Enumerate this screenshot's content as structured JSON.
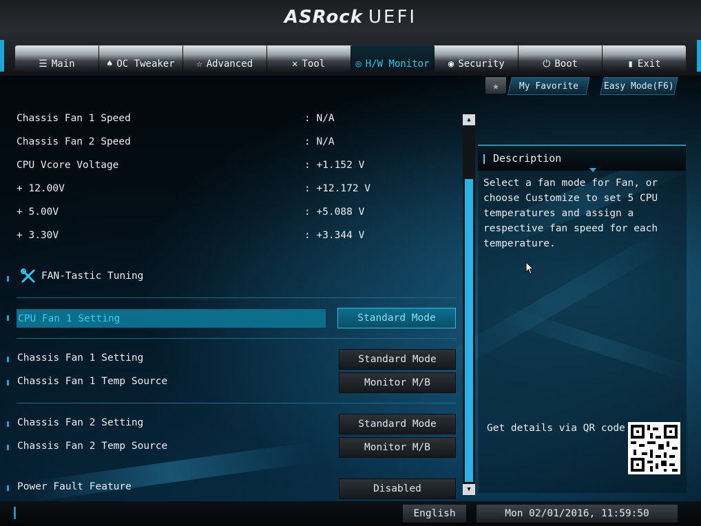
{
  "brand": {
    "name": "ASRock",
    "suffix": "UEFI"
  },
  "tabs": [
    {
      "icon": "list-icon",
      "glyph": "☰",
      "label": "Main"
    },
    {
      "icon": "flame-icon",
      "glyph": "♠",
      "label": "OC Tweaker"
    },
    {
      "icon": "star-icon",
      "glyph": "☆",
      "label": "Advanced"
    },
    {
      "icon": "tools-icon",
      "glyph": "✕",
      "label": "Tool"
    },
    {
      "icon": "monitor-icon",
      "glyph": "◎",
      "label": "H/W Monitor"
    },
    {
      "icon": "shield-icon",
      "glyph": "◉",
      "label": "Security"
    },
    {
      "icon": "power-icon",
      "glyph": "⏻",
      "label": "Boot"
    },
    {
      "icon": "exit-icon",
      "glyph": "▮",
      "label": "Exit"
    }
  ],
  "active_tab": "H/W Monitor",
  "favorites": {
    "my_favorite": "My Favorite",
    "easy_mode": "Easy Mode(F6)"
  },
  "readings": [
    {
      "label": "Chassis Fan 1 Speed",
      "value": ": N/A"
    },
    {
      "label": "Chassis Fan 2 Speed",
      "value": ": N/A"
    },
    {
      "label": "CPU Vcore Voltage",
      "value": ": +1.152 V"
    },
    {
      "label": "+ 12.00V",
      "value": ": +12.172 V"
    },
    {
      "label": "+ 5.00V",
      "value": ": +5.088 V"
    },
    {
      "label": "+ 3.30V",
      "value": ": +3.344 V"
    }
  ],
  "fan_tastic": {
    "label": "FAN-Tastic Tuning"
  },
  "settings": {
    "cpu_fan1": {
      "label": "CPU Fan 1 Setting",
      "value": "Standard Mode"
    },
    "chassis_fan1": {
      "label": "Chassis Fan 1 Setting",
      "value": "Standard Mode"
    },
    "chassis_fan1_src": {
      "label": "Chassis Fan 1 Temp Source",
      "value": "Monitor M/B"
    },
    "chassis_fan2": {
      "label": "Chassis Fan 2 Setting",
      "value": "Standard Mode"
    },
    "chassis_fan2_src": {
      "label": "Chassis Fan 2 Temp Source",
      "value": "Monitor M/B"
    },
    "power_fault": {
      "label": "Power Fault Feature",
      "value": "Disabled"
    }
  },
  "description": {
    "title": "Description",
    "text": "Select a fan mode for Fan, or choose Customize to set 5 CPU temperatures and assign a respective fan speed for each temperature.",
    "qr_label": "Get details via QR code"
  },
  "footer": {
    "language": "English",
    "datetime": "Mon 02/01/2016, 11:59:50"
  },
  "colors": {
    "accent": "#2fc6ef",
    "selected_row": "#0c6e8a",
    "scrollbar": "#28b3e6"
  }
}
